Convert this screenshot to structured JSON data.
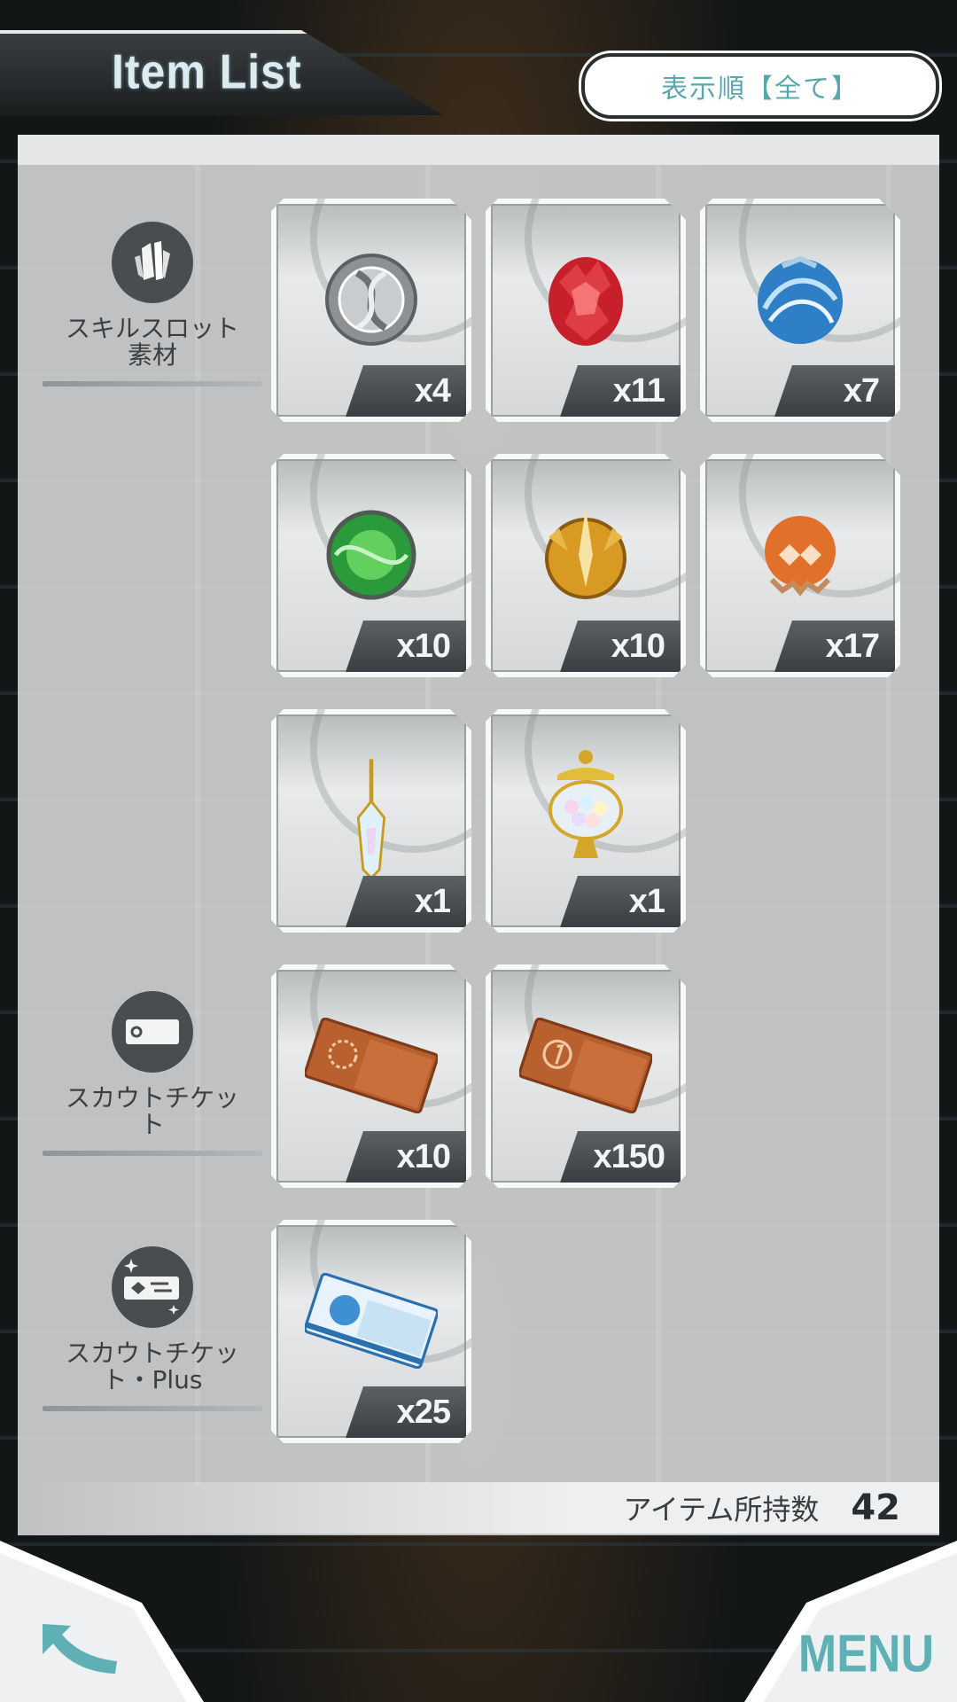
{
  "header": {
    "title": "Item List",
    "sort_label": "表示順【全て】"
  },
  "categories": [
    {
      "label": "スキルスロット\n素材",
      "icon": "crystal-icon"
    },
    {
      "label": "スカウトチケッ\nト",
      "icon": "ticket-icon"
    },
    {
      "label": "スカウトチケッ\nト・Plus",
      "icon": "ticket-plus-icon"
    }
  ],
  "items": [
    {
      "name": "silver-orb",
      "qty": "x4"
    },
    {
      "name": "red-orb",
      "qty": "x11"
    },
    {
      "name": "blue-orb",
      "qty": "x7"
    },
    {
      "name": "green-orb",
      "qty": "x10"
    },
    {
      "name": "gold-orb",
      "qty": "x10"
    },
    {
      "name": "orange-orb",
      "qty": "x17"
    },
    {
      "name": "crystal-wand",
      "qty": "x1"
    },
    {
      "name": "pearl-urn",
      "qty": "x1"
    },
    {
      "name": "bronze-ticket",
      "qty": "x10"
    },
    {
      "name": "bronze-ticket-1",
      "qty": "x150"
    },
    {
      "name": "blue-ticket-1st",
      "qty": "x25"
    }
  ],
  "footer": {
    "count_label": "アイテム所持数",
    "count_value": "42",
    "menu_label": "MENU"
  },
  "colors": {
    "accent": "#58a7ad",
    "panel": "#cdcfd0",
    "qty_badge": "#3b3e40"
  }
}
